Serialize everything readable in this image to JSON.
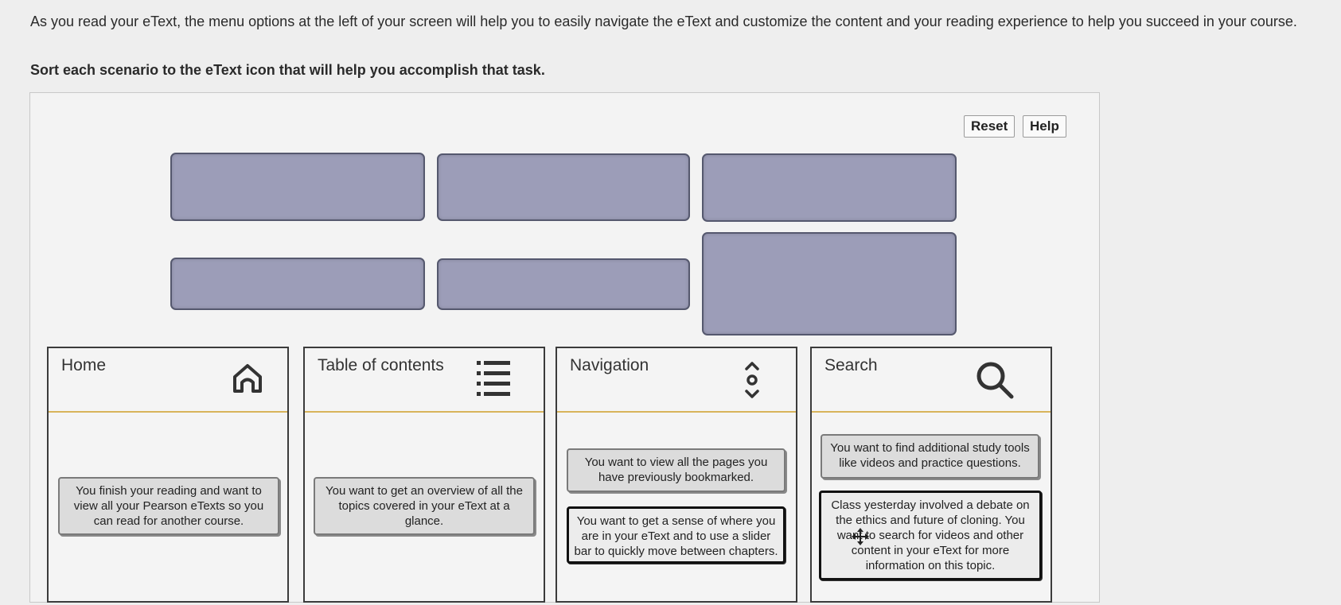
{
  "instructions": {
    "intro": "As you read your eText, the menu options at the left of your screen will help you to easily navigate the eText and customize the content and your reading experience to help you succeed in your course.",
    "prompt": "Sort each scenario to the eText icon that will help you accomplish that task."
  },
  "toolbar": {
    "reset_label": "Reset",
    "help_label": "Help"
  },
  "bins": [
    {
      "title": "Home",
      "icon": "home-icon"
    },
    {
      "title": "Table of contents",
      "icon": "list-icon"
    },
    {
      "title": "Navigation",
      "icon": "navigation-icon"
    },
    {
      "title": "Search",
      "icon": "search-icon"
    }
  ],
  "cards": {
    "home_1": "You finish your reading and want to view all your Pearson eTexts so you can read for another course.",
    "toc_1": "You want to get an overview of all the topics covered in your eText at a glance.",
    "nav_1": "You want to view all the pages you have previously bookmarked.",
    "nav_2": "You want to get a sense of where you are in your eText and to use a slider bar to quickly move between chapters.",
    "search_1": "You want to find additional study tools like videos and practice questions.",
    "search_2": "Class yesterday involved a debate on the ethics and future of cloning. You want to search for videos and other content in your eText for more information on this topic."
  },
  "colors": {
    "slot_fill": "#9c9db8",
    "bin_divider": "#d8b45a"
  }
}
